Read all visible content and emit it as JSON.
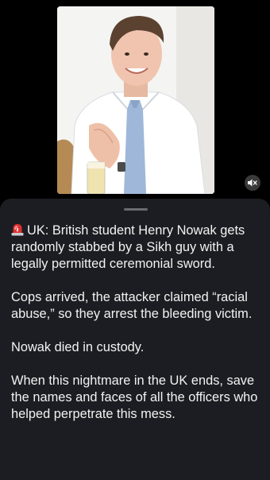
{
  "media": {
    "photo_alt": "",
    "mute_icon": "speaker-muted-icon"
  },
  "caption": {
    "alarm_icon": "rotating-light-icon",
    "paragraphs": [
      "UK: British student Henry Nowak gets randomly stabbed by a Sikh guy with a legally permitted ceremonial sword.",
      "Cops arrived, the attacker claimed “racial abuse,” so they arrest the bleeding victim.",
      "Nowak died in custody.",
      "When this nightmare in the UK ends, save the names and faces of all the officers who helped perpetrate this mess."
    ]
  },
  "colors": {
    "background": "#000000",
    "sheet": "#1c1d22",
    "text": "#f2f2f2",
    "alarm_red": "#e0312f"
  }
}
